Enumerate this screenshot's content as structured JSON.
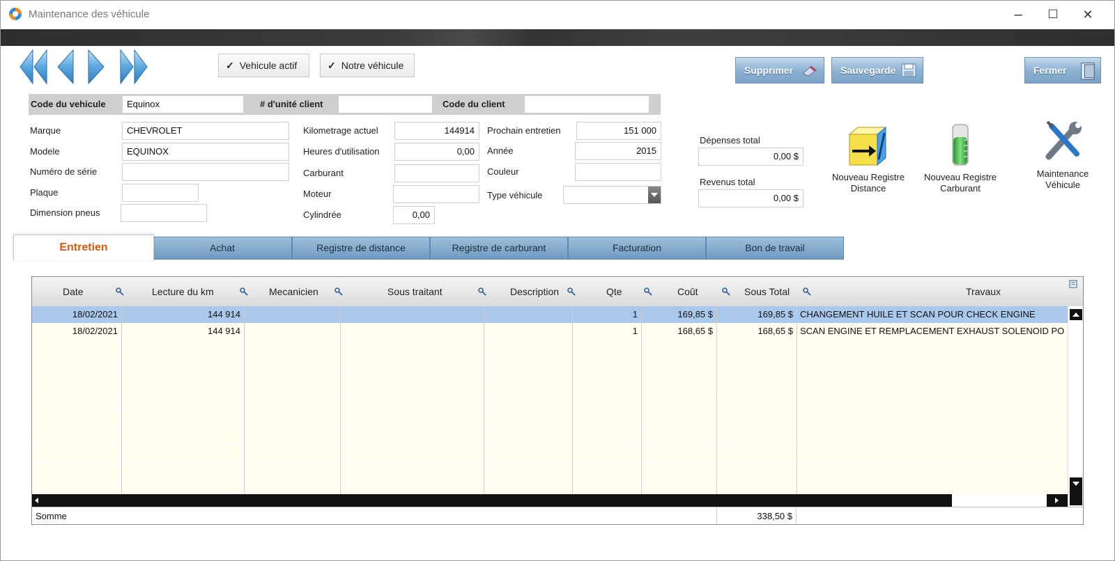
{
  "window": {
    "title": "Maintenance des véhicule",
    "minimize": "–",
    "maximize": "☐",
    "close": "✕"
  },
  "checkboxes": {
    "vehicule_actif": {
      "label": "Vehicule actif",
      "checked": true,
      "mark": "✓"
    },
    "notre_vehicule": {
      "label": "Notre véhicule",
      "checked": true,
      "mark": "✓"
    }
  },
  "actions": {
    "delete": "Supprimer",
    "save": "Sauvegarde",
    "close": "Fermer"
  },
  "header": {
    "code_vehicule_label": "Code du vehicule",
    "code_vehicule_value": "Equinox",
    "unite_client_label": "# d'unité client",
    "unite_client_value": "",
    "code_client_label": "Code du client",
    "code_client_value": ""
  },
  "fields": {
    "marque": {
      "label": "Marque",
      "value": "CHEVROLET"
    },
    "modele": {
      "label": "Modele",
      "value": "EQUINOX"
    },
    "numero_serie": {
      "label": "Numéro de série",
      "value": ""
    },
    "plaque": {
      "label": "Plaque",
      "value": ""
    },
    "dimension_pneus": {
      "label": "Dimension pneus",
      "value": ""
    },
    "kilometrage": {
      "label": "Kilometrage actuel",
      "value": "144914"
    },
    "heures": {
      "label": "Heures d'utilisation",
      "value": "0,00"
    },
    "carburant": {
      "label": "Carburant",
      "value": ""
    },
    "moteur": {
      "label": "Moteur",
      "value": ""
    },
    "cylindree": {
      "label": "Cylindrée",
      "value": "0,00"
    },
    "prochain_entretien": {
      "label": "Prochain entretien",
      "value": "151 000"
    },
    "annee": {
      "label": "Année",
      "value": "2015"
    },
    "couleur": {
      "label": "Couleur",
      "value": ""
    },
    "type_vehicule": {
      "label": "Type véhicule",
      "value": ""
    }
  },
  "totals": {
    "depenses": {
      "label": "Dépenses total",
      "value": "0,00 $"
    },
    "revenus": {
      "label": "Revenus total",
      "value": "0,00 $"
    }
  },
  "tools": {
    "registre_distance": {
      "line1": "Nouveau Registre",
      "line2": "Distance",
      "icon": "distance-register-icon"
    },
    "registre_carburant": {
      "line1": "Nouveau Registre",
      "line2": "Carburant",
      "icon": "fuel-gauge-icon"
    },
    "maintenance": {
      "line1": "Maintenance",
      "line2": "Véhicule",
      "icon": "wrench-screwdriver-icon"
    }
  },
  "tabs": [
    {
      "label": "Entretien",
      "active": true
    },
    {
      "label": "Achat",
      "active": false
    },
    {
      "label": "Registre de distance",
      "active": false
    },
    {
      "label": "Registre de carburant",
      "active": false
    },
    {
      "label": "Facturation",
      "active": false
    },
    {
      "label": "Bon de travail",
      "active": false
    }
  ],
  "grid": {
    "columns": [
      "Date",
      "Lecture du km",
      "Mecanicien",
      "Sous traitant",
      "Description",
      "Qte",
      "Coût",
      "Sous Total",
      "Travaux"
    ],
    "rows": [
      {
        "date": "18/02/2021",
        "km": "144 914",
        "mecanicien": "",
        "sous_traitant": "",
        "description": "",
        "qte": "1",
        "cout": "169,85 $",
        "sous_total": "169,85 $",
        "travaux": "CHANGEMENT HUILE ET SCAN POUR CHECK ENGINE",
        "selected": true
      },
      {
        "date": "18/02/2021",
        "km": "144 914",
        "mecanicien": "",
        "sous_traitant": "",
        "description": "",
        "qte": "1",
        "cout": "168,65 $",
        "sous_total": "168,65 $",
        "travaux": "SCAN ENGINE ET REMPLACEMENT EXHAUST SOLENOID PO",
        "selected": false
      }
    ],
    "sum_label": "Somme",
    "sum_value": "338,50 $"
  },
  "colors": {
    "accent_blue": "#7aa2c6",
    "selection": "#a9c8ec",
    "active_tab_text": "#d25a12",
    "row_alt": "#fffef0"
  }
}
